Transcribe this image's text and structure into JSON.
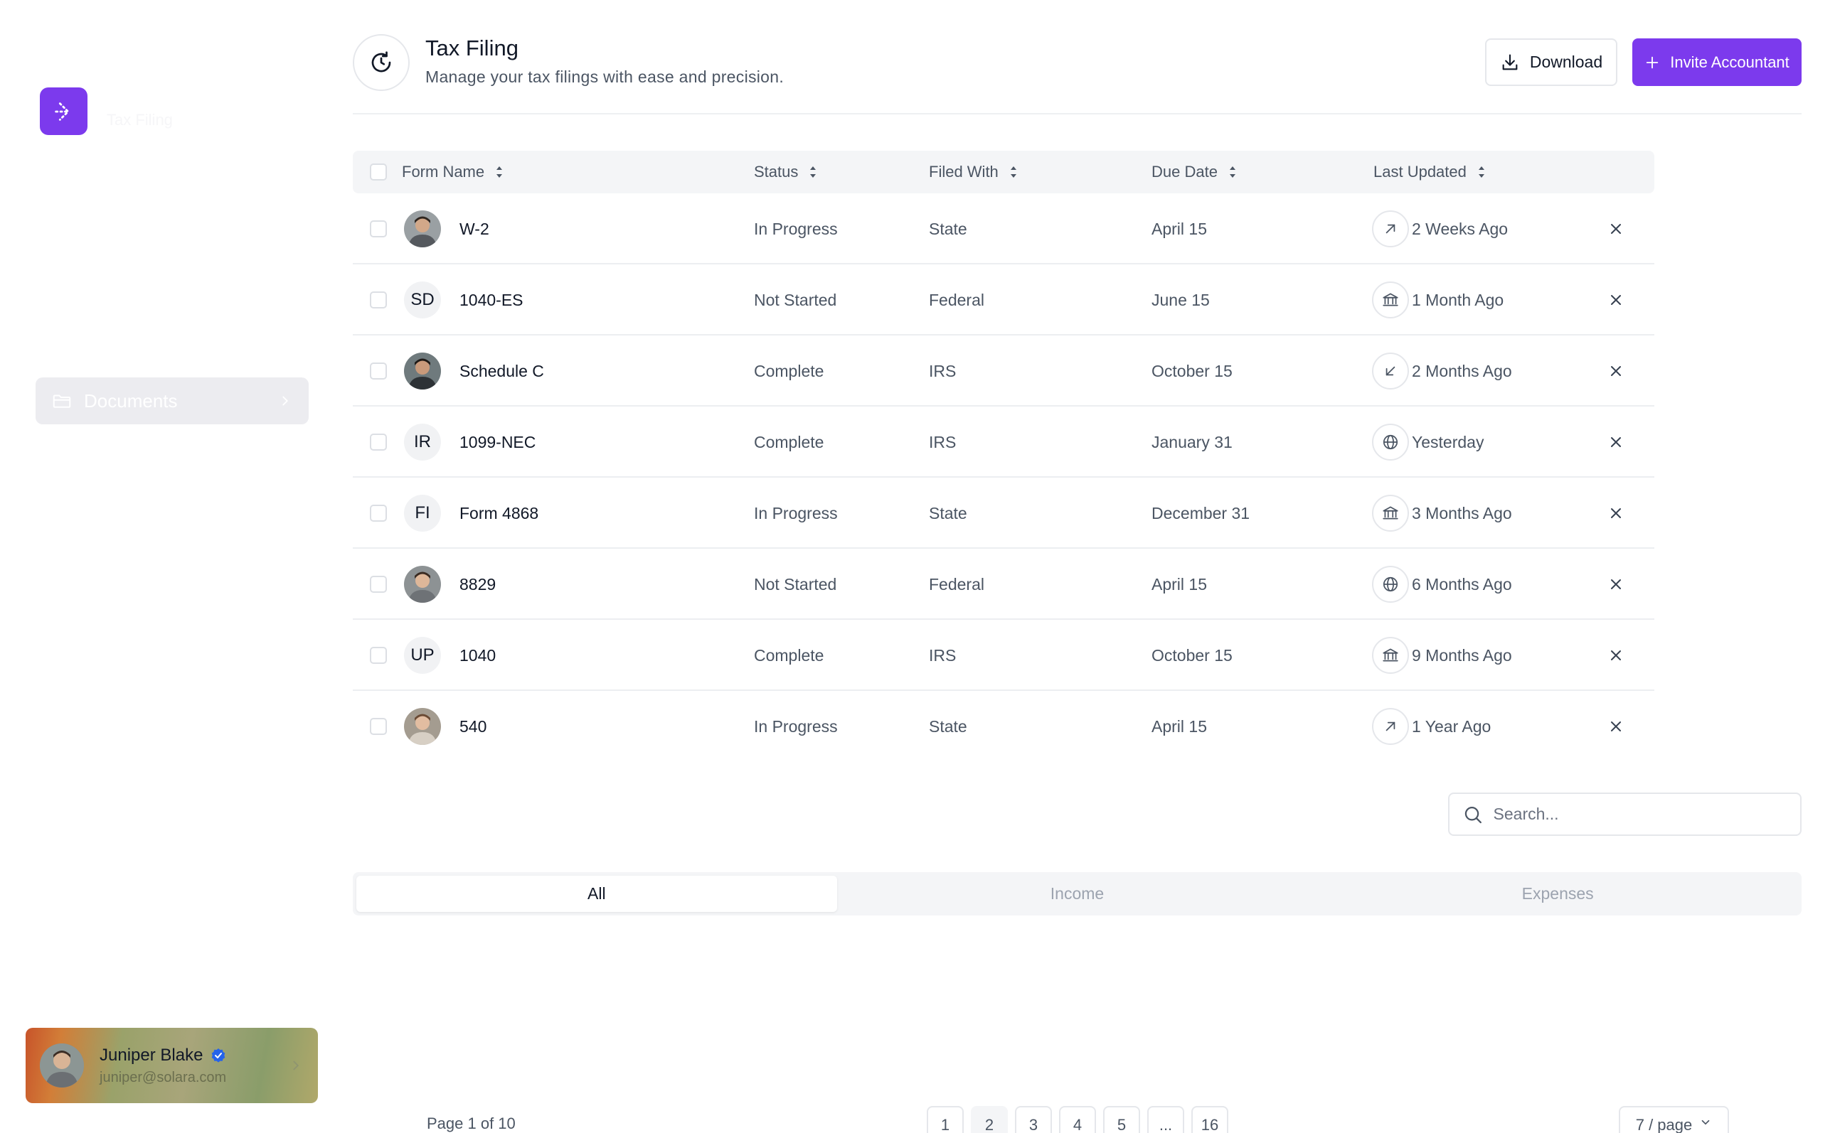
{
  "sidebar": {
    "logo_text": "Tax Filing",
    "nav": [
      {
        "label": "Documents"
      }
    ],
    "user": {
      "name": "Juniper Blake",
      "email": "juniper@solara.com"
    }
  },
  "header": {
    "title": "Tax Filing",
    "subtitle": "Manage your tax filings with ease and precision.",
    "download_label": "Download",
    "invite_label": "Invite Accountant"
  },
  "table": {
    "columns": [
      "Form Name",
      "Status",
      "Filed With",
      "Due Date",
      "Last Updated"
    ],
    "rows": [
      {
        "form": "W-2",
        "avatar": "photo",
        "initials": "",
        "status": "In Progress",
        "filed_with": "State",
        "due": "April 15",
        "updated_icon": "arrow-up-right-icon",
        "updated": "2 Weeks Ago"
      },
      {
        "form": "1040-ES",
        "avatar": "initials",
        "initials": "SD",
        "status": "Not Started",
        "filed_with": "Federal",
        "due": "June 15",
        "updated_icon": "bank-icon",
        "updated": "1 Month Ago"
      },
      {
        "form": "Schedule C",
        "avatar": "photo",
        "initials": "",
        "status": "Complete",
        "filed_with": "IRS",
        "due": "October 15",
        "updated_icon": "arrow-down-left-icon",
        "updated": "2 Months Ago"
      },
      {
        "form": "1099-NEC",
        "avatar": "initials",
        "initials": "IR",
        "status": "Complete",
        "filed_with": "IRS",
        "due": "January 31",
        "updated_icon": "globe-icon",
        "updated": "Yesterday"
      },
      {
        "form": "Form 4868",
        "avatar": "initials",
        "initials": "FI",
        "status": "In Progress",
        "filed_with": "State",
        "due": "December 31",
        "updated_icon": "bank-icon",
        "updated": "3 Months Ago"
      },
      {
        "form": "8829",
        "avatar": "photo",
        "initials": "",
        "status": "Not Started",
        "filed_with": "Federal",
        "due": "April 15",
        "updated_icon": "globe-icon",
        "updated": "6 Months Ago"
      },
      {
        "form": "1040",
        "avatar": "initials",
        "initials": "UP",
        "status": "Complete",
        "filed_with": "IRS",
        "due": "October 15",
        "updated_icon": "bank-icon",
        "updated": "9 Months Ago"
      },
      {
        "form": "540",
        "avatar": "photo",
        "initials": "",
        "status": "In Progress",
        "filed_with": "State",
        "due": "April 15",
        "updated_icon": "arrow-up-right-icon",
        "updated": "1 Year Ago"
      }
    ]
  },
  "search": {
    "placeholder": "Search...",
    "value": ""
  },
  "tabs": [
    {
      "label": "All",
      "active": true
    },
    {
      "label": "Income",
      "active": false
    },
    {
      "label": "Expenses",
      "active": false
    }
  ],
  "pagination": {
    "info": "Page 1 of 10",
    "pages": [
      "1",
      "2",
      "3",
      "4",
      "5",
      "...",
      "16"
    ],
    "active_page": "2",
    "per_page": "7 / page"
  },
  "colors": {
    "accent": "#7c3aed",
    "verified": "#2563eb"
  }
}
